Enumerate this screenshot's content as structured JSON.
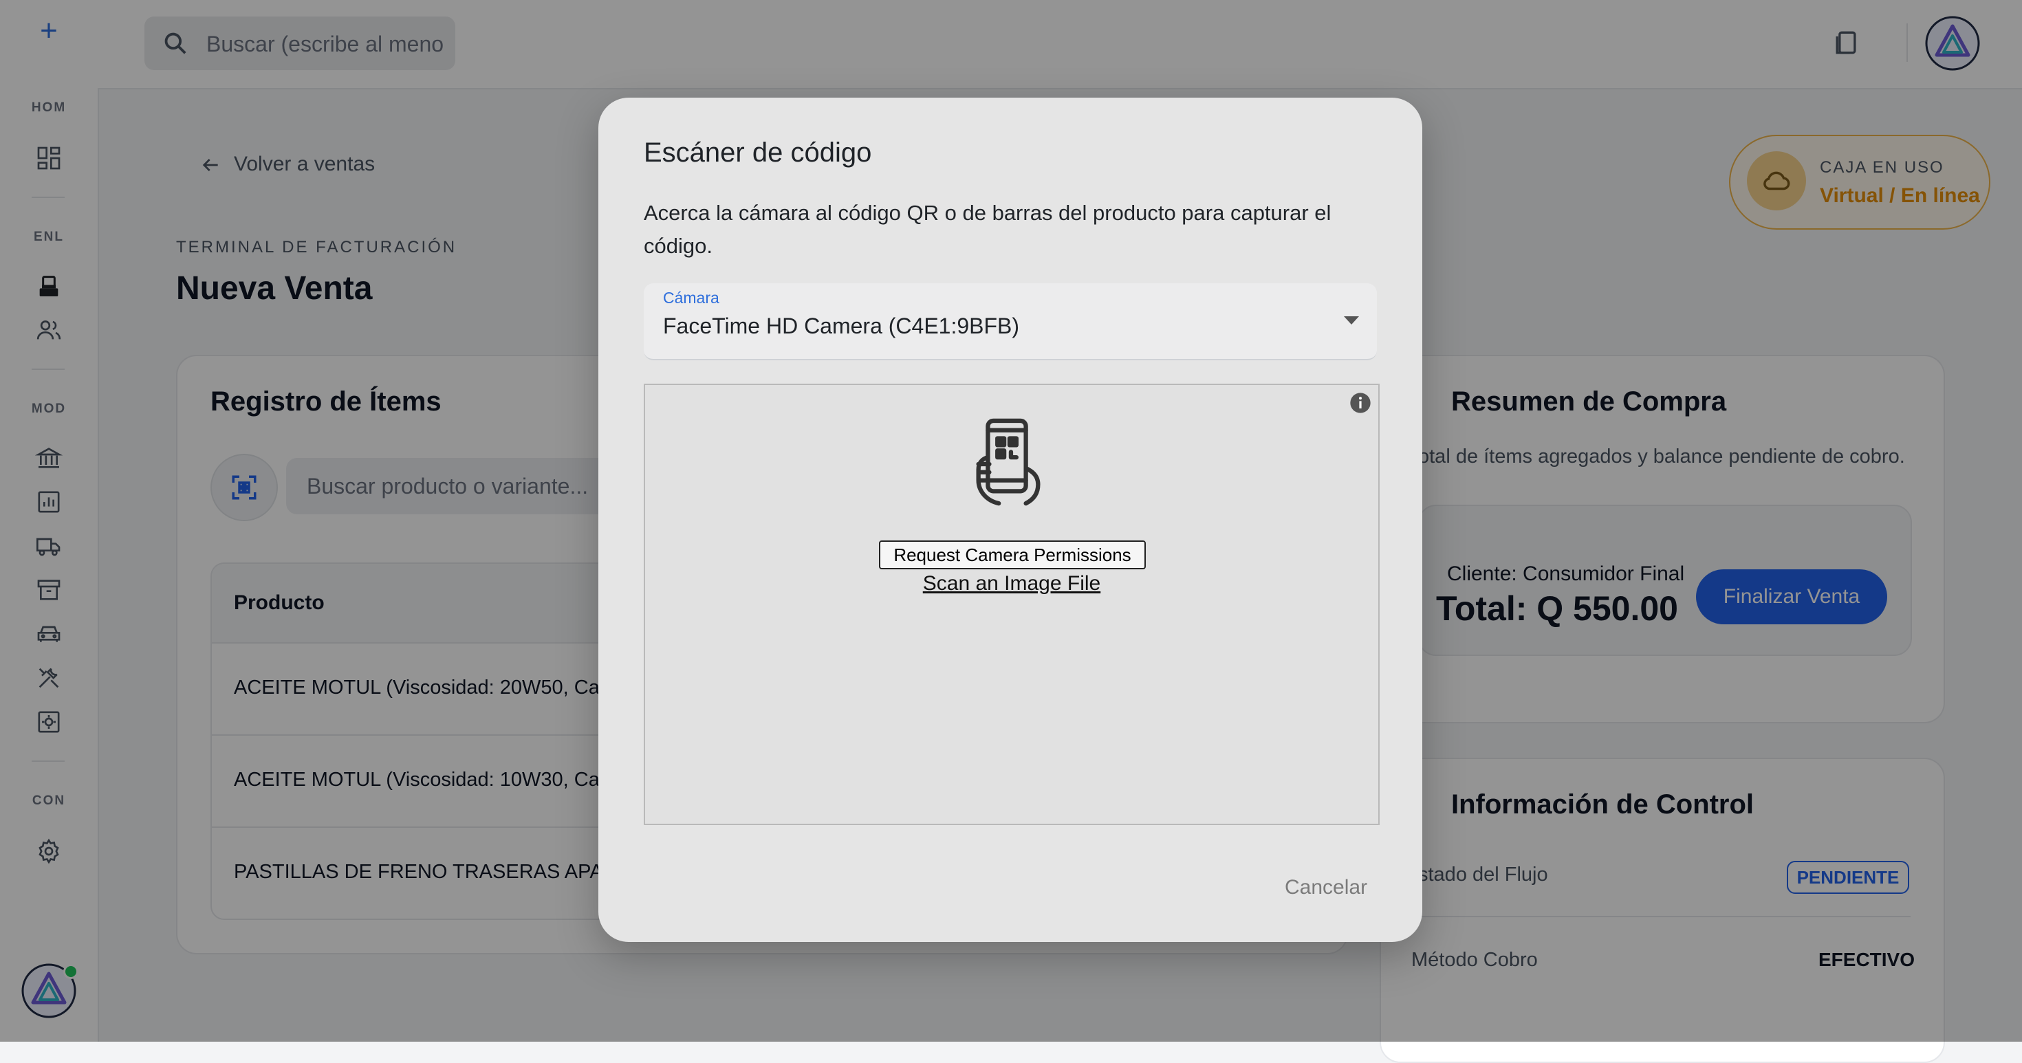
{
  "sidebar": {
    "sections": [
      "HOM",
      "ENL",
      "MOD",
      "CON"
    ]
  },
  "topbar": {
    "search_placeholder": "Buscar (escribe al meno"
  },
  "page": {
    "back_label": "Volver a ventas",
    "overline": "TERMINAL DE FACTURACIÓN",
    "title": "Nueva Venta"
  },
  "items_card": {
    "title": "Registro de Ítems",
    "search_placeholder": "Buscar producto o variante...",
    "table": {
      "header": "Producto",
      "rows": [
        "ACEITE MOTUL (Viscosidad: 20W50, Cali",
        "ACEITE MOTUL (Viscosidad: 10W30, Cali",
        "PASTILLAS DE FRENO TRASERAS APACH"
      ]
    }
  },
  "caja": {
    "label": "CAJA EN USO",
    "status": "Virtual / En línea"
  },
  "summary": {
    "title": "Resumen de Compra",
    "subtitle": "otal de ítems agregados y balance pendiente de cobro.",
    "client": "Cliente: Consumidor Final",
    "total": "Total: Q 550.00",
    "finalize_label": "Finalizar Venta"
  },
  "control": {
    "title": "Información de Control",
    "flow_label": "stado del Flujo",
    "flow_status": "PENDIENTE",
    "method_label": "Método Cobro",
    "method_value": "EFECTIVO"
  },
  "dialog": {
    "title": "Escáner de código",
    "description": "Acerca la cámara al código QR o de barras del producto para capturar el código.",
    "camera_label": "Cámara",
    "camera_value": "FaceTime HD Camera (C4E1:9BFB)",
    "request_permissions": "Request Camera Permissions",
    "scan_file": "Scan an Image File",
    "cancel": "Cancelar"
  },
  "colors": {
    "accent": "#2463eb",
    "warning": "#e58f0b",
    "scrim": "rgba(0,0,0,0.42)"
  }
}
